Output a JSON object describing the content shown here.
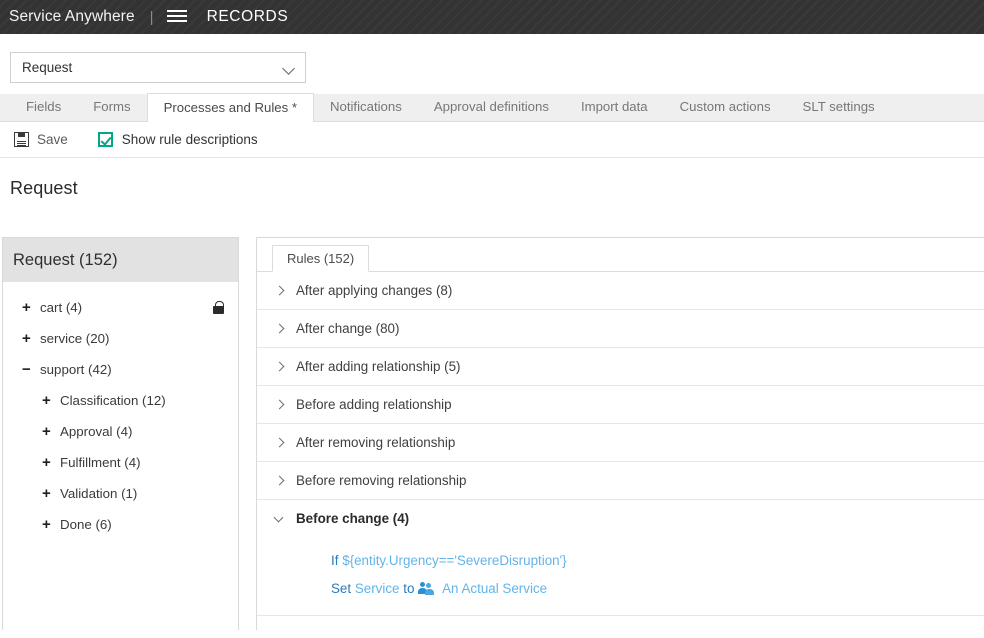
{
  "topbar": {
    "brand": "Service Anywhere",
    "separator": "|",
    "menu_icon": "hamburger-icon",
    "section": "RECORDS"
  },
  "selector": {
    "value": "Request",
    "icon": "chevron-down-icon"
  },
  "tabs": [
    {
      "label": "Fields",
      "active": false
    },
    {
      "label": "Forms",
      "active": false
    },
    {
      "label": "Processes and Rules *",
      "active": true
    },
    {
      "label": "Notifications",
      "active": false
    },
    {
      "label": "Approval definitions",
      "active": false
    },
    {
      "label": "Import data",
      "active": false
    },
    {
      "label": "Custom actions",
      "active": false
    },
    {
      "label": "SLT settings",
      "active": false
    }
  ],
  "toolbar": {
    "save_label": "Save",
    "save_icon": "floppy-disk-icon",
    "show_rule_descriptions_label": "Show rule descriptions",
    "show_rule_descriptions_checked": true
  },
  "page_title": "Request",
  "tree": {
    "header": "Request (152)",
    "items": [
      {
        "label": "cart (4)",
        "toggle": "+",
        "level": 1,
        "locked": true
      },
      {
        "label": "service (20)",
        "toggle": "+",
        "level": 1,
        "locked": false
      },
      {
        "label": "support (42)",
        "toggle": "−",
        "level": 1,
        "locked": false
      },
      {
        "label": "Classification (12)",
        "toggle": "+",
        "level": 2,
        "locked": false
      },
      {
        "label": "Approval (4)",
        "toggle": "+",
        "level": 2,
        "locked": false
      },
      {
        "label": "Fulfillment (4)",
        "toggle": "+",
        "level": 2,
        "locked": false
      },
      {
        "label": "Validation (1)",
        "toggle": "+",
        "level": 2,
        "locked": false
      },
      {
        "label": "Done (6)",
        "toggle": "+",
        "level": 2,
        "locked": false
      }
    ]
  },
  "rules": {
    "tab_label": "Rules (152)",
    "groups": [
      {
        "label": "After applying changes (8)",
        "expanded": false
      },
      {
        "label": "After change (80)",
        "expanded": false
      },
      {
        "label": "After adding relationship (5)",
        "expanded": false
      },
      {
        "label": "Before adding relationship",
        "expanded": false
      },
      {
        "label": "After removing relationship",
        "expanded": false
      },
      {
        "label": "Before removing relationship",
        "expanded": false
      },
      {
        "label": "Before change (4)",
        "expanded": true
      }
    ],
    "expanded_rule": {
      "if_keyword": "If",
      "if_expression": "${entity.Urgency=='SevereDisruption'}",
      "set_keyword": "Set",
      "set_field": "Service",
      "to_keyword": "to",
      "value_icon": "people-group-icon",
      "set_value": "An Actual Service"
    }
  },
  "colors": {
    "topbar_bg": "#333333",
    "accent_teal": "#00a887",
    "link_blue": "#2a7bbd",
    "light_blue": "#62b4e8",
    "tabstrip_bg": "#efefef",
    "tree_header_bg": "#e2e2e2"
  }
}
